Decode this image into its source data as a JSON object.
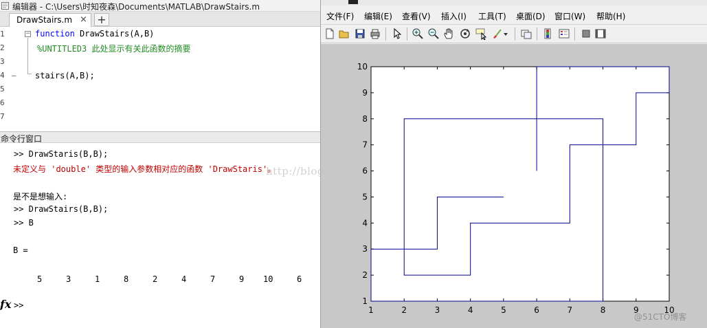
{
  "editor": {
    "window_title": "编辑器 - C:\\Users\\时知夜森\\Documents\\MATLAB\\DrawStairs.m",
    "tab": {
      "label": "DrawStairs.m",
      "close": "×"
    },
    "new_tab": "+",
    "line_numbers": [
      "1",
      "2",
      "3",
      "4",
      "5",
      "6",
      "7"
    ],
    "lines": {
      "l1_keyword": "function",
      "l1_rest": " DrawStairs(A,B)",
      "l2_comment": "%UNTITLED3 此处显示有关此函数的摘要",
      "l4_code": "stairs(A,B);"
    },
    "dash": "–"
  },
  "command_window": {
    "title": "命令行窗口",
    "line1": ">> DrawStaris(B,B);",
    "error": "未定义与 'double' 类型的输入参数相对应的函数 'DrawStaris'。",
    "suggest": "是不是想输入:",
    "line_suggest": ">> DrawStairs(B,B);",
    "line_b": ">> B",
    "b_eq": "B =",
    "b_values": [
      "5",
      "3",
      "1",
      "8",
      "2",
      "4",
      "7",
      "9",
      "10",
      "6"
    ],
    "fx": "fx",
    "prompt": ">>"
  },
  "watermark": "http://blog.csdn.net/liu16659",
  "figure": {
    "menu": [
      "文件(F)",
      "编辑(E)",
      "查看(V)",
      "插入(I)",
      "工具(T)",
      "桌面(D)",
      "窗口(W)",
      "帮助(H)"
    ],
    "toolbar_icons": [
      "new-figure-icon",
      "open-file-icon",
      "save-icon",
      "print-icon",
      "edit-plot-arrow-icon",
      "zoom-in-icon",
      "zoom-out-icon",
      "pan-hand-icon",
      "rotate-3d-icon",
      "data-cursor-icon",
      "brush-icon",
      "brush-dropdown-icon",
      "link-plot-icon",
      "insert-colorbar-icon",
      "insert-legend-icon",
      "hide-plot-tools-icon",
      "show-plot-tools-icon"
    ],
    "corner_mark": "@51CTO博客"
  },
  "chart_data": {
    "type": "line",
    "title": "",
    "xlabel": "",
    "ylabel": "",
    "xlim": [
      1,
      10
    ],
    "ylim": [
      1,
      10
    ],
    "x_ticks": [
      1,
      2,
      3,
      4,
      5,
      6,
      7,
      8,
      9,
      10
    ],
    "y_ticks": [
      1,
      2,
      3,
      4,
      5,
      6,
      7,
      8,
      9,
      10
    ],
    "grid": false,
    "line_color": "#00008b",
    "series": [
      {
        "x": [
          5,
          3,
          1,
          8,
          2,
          4,
          7,
          9,
          10,
          6
        ],
        "y": [
          5,
          3,
          1,
          8,
          2,
          4,
          7,
          9,
          10,
          6
        ],
        "style": "stairs"
      }
    ]
  }
}
